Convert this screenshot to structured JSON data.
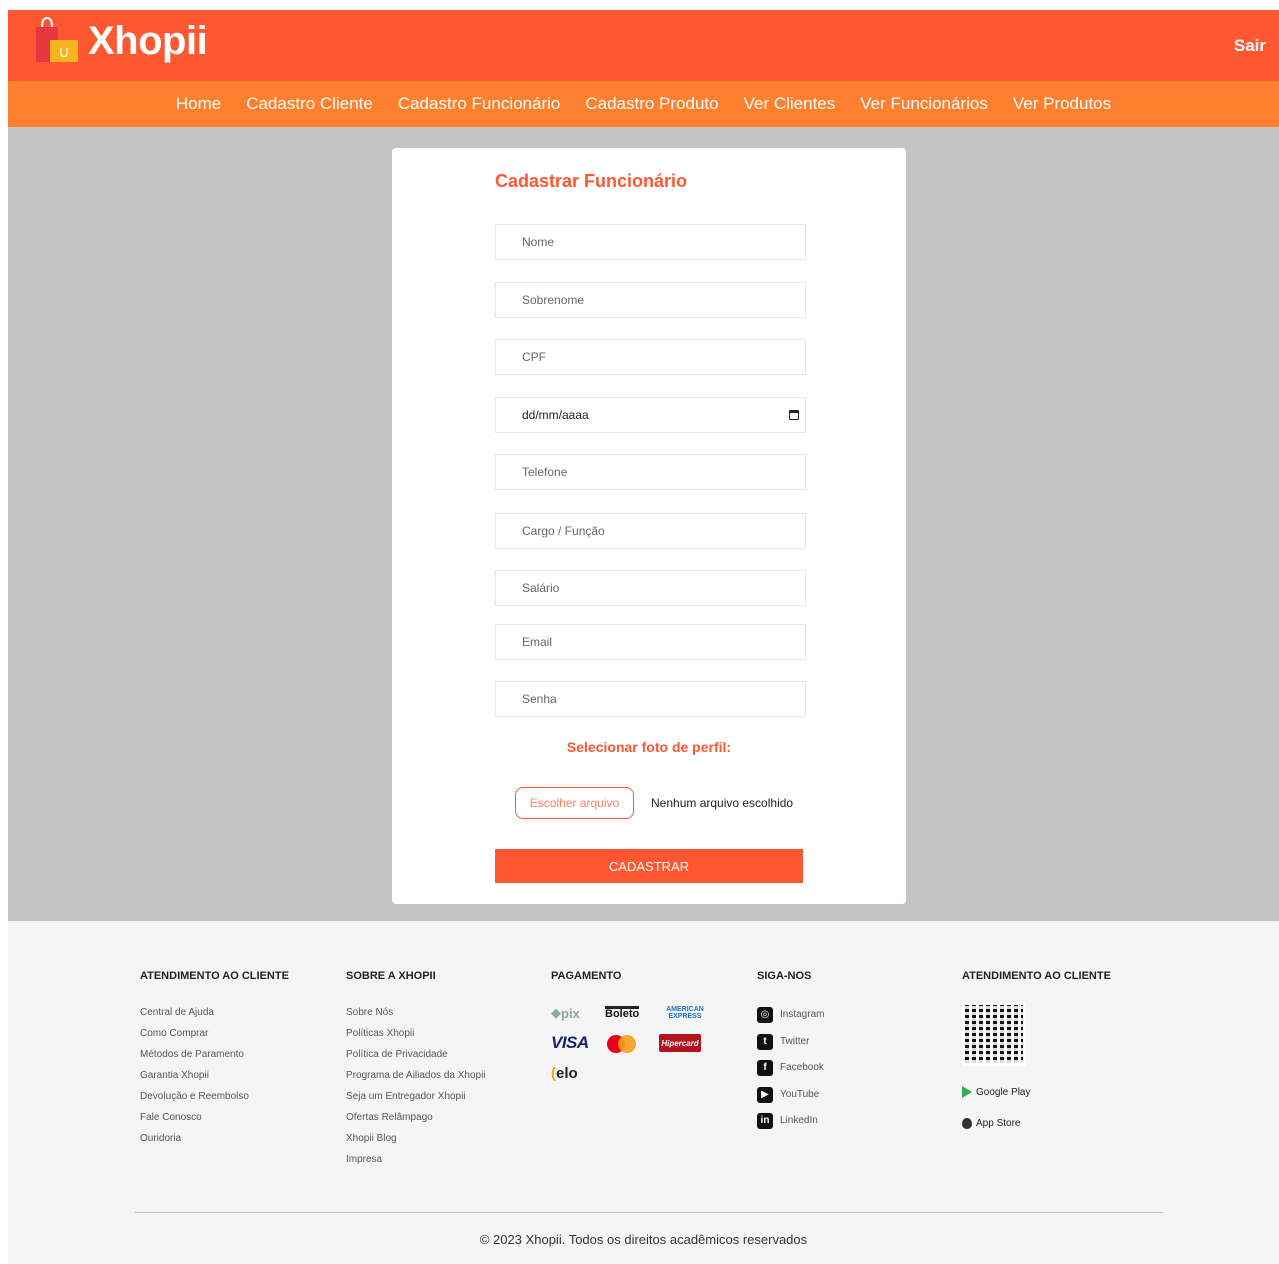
{
  "header": {
    "brand": "Xhopii",
    "logo_letter": "U",
    "logout_label": "Sair"
  },
  "nav": {
    "items": [
      "Home",
      "Cadastro Cliente",
      "Cadastro Funcionário",
      "Cadastro Produto",
      "Ver Clientes",
      "Ver Funcionários",
      "Ver Produtos"
    ]
  },
  "form": {
    "title": "Cadastrar Funcionário",
    "nome_placeholder": "Nome",
    "sobrenome_placeholder": "Sobrenome",
    "cpf_placeholder": "CPF",
    "data_value": "dd/mm/aaaa",
    "telefone_placeholder": "Telefone",
    "cargo_placeholder": "Cargo / Função",
    "salario_placeholder": "Salário",
    "email_placeholder": "Email",
    "senha_placeholder": "Senha",
    "photo_label": "Selecionar foto de perfil:",
    "file_button": "Escolher arquivo",
    "file_status": "Nenhum arquivo escolhido",
    "submit_label": "CADASTRAR"
  },
  "footer": {
    "col1": {
      "title": "ATENDIMENTO AO CLIENTE",
      "items": [
        "Central de Ajuda",
        "Como Comprar",
        "Métodos de Paramento",
        "Garantia Xhopii",
        "Devolução e Reembolso",
        "Fale Conosco",
        "Ouridoria"
      ]
    },
    "col2": {
      "title": "SOBRE A XHOPII",
      "items": [
        "Sobre Nós",
        "Políticas Xhopii",
        "Política de Privacidade",
        "Programa de Ailiados da Xhopii",
        "Seja um Entregador Xhopii",
        "Ofertas Relâmpago",
        "Xhopii Blog",
        "Impresa"
      ]
    },
    "col3": {
      "title": "PAGAMENTO",
      "pix": "pix",
      "boleto": "Boleto",
      "amex_line1": "AMERICAN",
      "amex_line2": "EXPRESS",
      "visa": "VISA",
      "hipercard": "Hipercard",
      "elo_mark": "(",
      "elo": "elo"
    },
    "col4": {
      "title": "SIGA-NOS",
      "items": [
        "Instagram",
        "Twitter",
        "Facebook",
        "YouTube",
        "LinkedIn"
      ],
      "icon_glyphs": [
        "◎",
        "t",
        "f",
        "▶",
        "in"
      ]
    },
    "col5": {
      "title": "ATENDIMENTO AO CLIENTE",
      "google_play": "Google Play",
      "app_store": "App Store"
    },
    "copyright": "© 2023 Xhopii. Todos os direitos acadêmicos reservados"
  },
  "colors": {
    "header": "#fe5731",
    "nav": "#fe7f2d",
    "background": "#c4c4c4",
    "accent": "#fe5731"
  }
}
